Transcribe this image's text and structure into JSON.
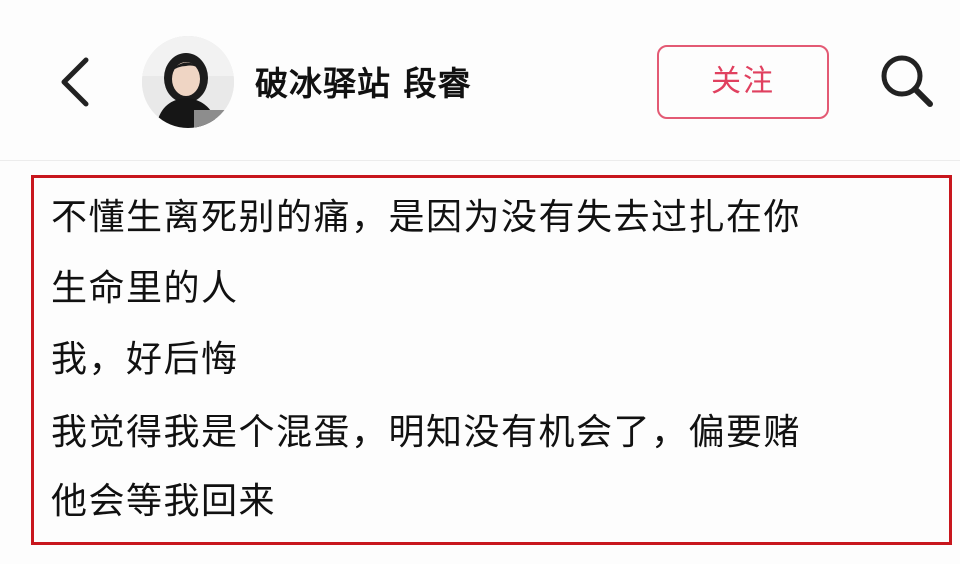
{
  "header": {
    "username": "破冰驿站 段睿",
    "follow_label": "关注",
    "back_icon": "chevron-left-icon",
    "search_icon": "search-icon"
  },
  "post": {
    "lines": [
      "不懂生离死别的痛，是因为没有失去过扎在你",
      "生命里的人",
      "我，好后悔",
      "我觉得我是个混蛋，明知没有机会了，偏要赌",
      "他会等我回来"
    ],
    "highlight_border_color": "#c8161d"
  },
  "colors": {
    "accent": "#e0405f"
  }
}
